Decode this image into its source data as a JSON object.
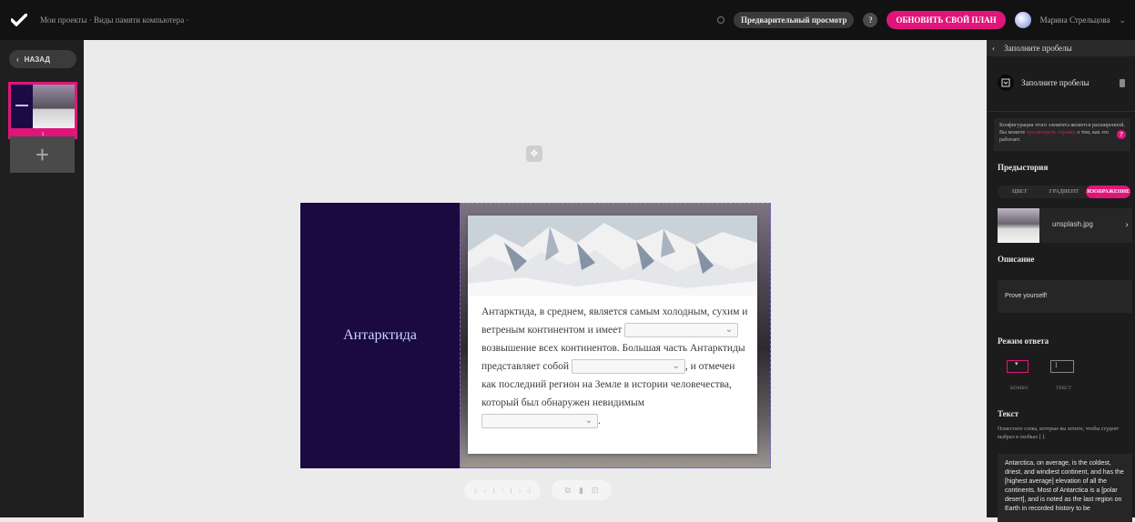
{
  "topbar": {
    "breadcrumb": "Мои проекты · Виды памяти компьютера ·",
    "preview_label": "Предварительный просмотр",
    "help_label": "?",
    "upgrade_label": "ОБНОВИТЬ СВОЙ ПЛАН",
    "username": "Марина Стрельцова",
    "chevron": "⌄"
  },
  "leftbar": {
    "back_label": "НАЗАД",
    "back_chevron": "‹",
    "slide_number": "1",
    "add_slide": "+"
  },
  "slide": {
    "title": "Антарктида",
    "text_parts": [
      "Антарктида, в среднем, является самым холодным, сухим и ветреным континентом и имеет",
      "возвышение всех континентов. Большая часть Антарктиды представляет собой",
      ", и отмечен как последний регион на Земле в истории человечества, который был обнаружен невидимым",
      "."
    ],
    "move_handle": "✥"
  },
  "slide_controls": {
    "pager": [
      "|‹",
      "‹",
      "1",
      "/",
      "1",
      "›",
      "›|"
    ],
    "tools": [
      "⧉",
      "▮",
      "⊡"
    ]
  },
  "rightbar": {
    "header_title": "Заполните пробелы",
    "header_back": "‹",
    "widget_title": "Заполните пробелы",
    "notice_text": "Конфигурация этого элемента является расширенной. Вы можете",
    "notice_link": "просмотреть справку",
    "notice_text2": "о том, как это работает.",
    "notice_icon": "?",
    "background_label": "Предыстория",
    "bg_tabs": [
      "ЦВЕТ",
      "ГРАДИЕНТ",
      "ИЗОБРАЖЕНИЕ"
    ],
    "image_name": "unsplash.jpg",
    "image_chevron": "›",
    "description_label": "Описание",
    "description_value": "Prove yourself!",
    "answer_mode_label": "Режим ответа",
    "mode_combo_label": "КОМБО",
    "mode_text_label": "ТЕКСТ",
    "text_label": "Текст",
    "text_help": "Поместите слова, которые вы хотите, чтобы студент выбрал в скобках [ ].",
    "text_value": "Antarctica, on average, is the coldest, driest, and windiest continent, and has the [highest average] elevation of all the continents.  Most of Antarctica is a [polar desert], and is noted as the last region on Earth in recorded history to be"
  },
  "colors": {
    "accent": "#e0157a",
    "slide_bg": "#1a0a3f",
    "panel_bg": "#1c1c1c"
  }
}
